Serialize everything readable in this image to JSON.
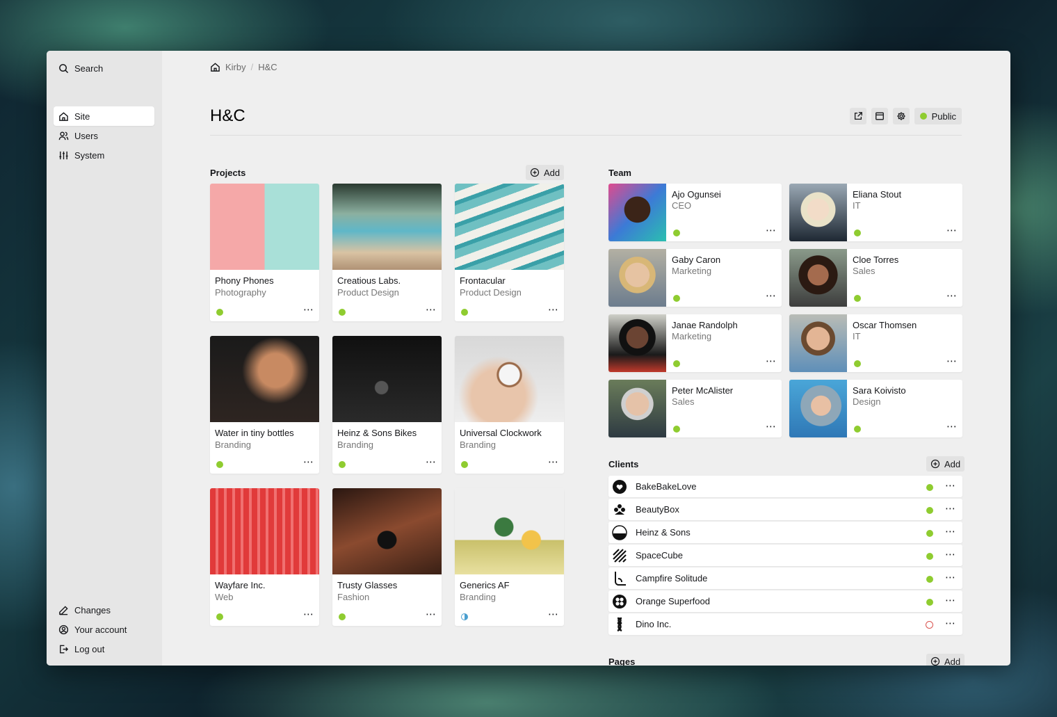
{
  "sidebar": {
    "search_label": "Search",
    "nav": [
      {
        "label": "Site",
        "active": true
      },
      {
        "label": "Users"
      },
      {
        "label": "System"
      }
    ],
    "bottom": [
      {
        "label": "Changes"
      },
      {
        "label": "Your account"
      },
      {
        "label": "Log out"
      }
    ]
  },
  "breadcrumb": {
    "root": "Kirby",
    "current": "H&C",
    "separator": "/"
  },
  "page": {
    "title": "H&C",
    "status_label": "Public",
    "status_color": "#8fcc30"
  },
  "projects": {
    "title": "Projects",
    "add_label": "Add",
    "items": [
      {
        "title": "Phony Phones",
        "category": "Photography",
        "status": "published"
      },
      {
        "title": "Creatious Labs.",
        "category": "Product Design",
        "status": "published"
      },
      {
        "title": "Frontacular",
        "category": "Product Design",
        "status": "published"
      },
      {
        "title": "Water in tiny bottles",
        "category": "Branding",
        "status": "published"
      },
      {
        "title": "Heinz & Sons Bikes",
        "category": "Branding",
        "status": "published"
      },
      {
        "title": "Universal Clockwork",
        "category": "Branding",
        "status": "published"
      },
      {
        "title": "Wayfare Inc.",
        "category": "Web",
        "status": "published"
      },
      {
        "title": "Trusty Glasses",
        "category": "Fashion",
        "status": "published"
      },
      {
        "title": "Generics AF",
        "category": "Branding",
        "status": "unlisted"
      }
    ]
  },
  "team": {
    "title": "Team",
    "members": [
      {
        "name": "Ajo Ogunsei",
        "role": "CEO"
      },
      {
        "name": "Eliana Stout",
        "role": "IT"
      },
      {
        "name": "Gaby Caron",
        "role": "Marketing"
      },
      {
        "name": "Cloe Torres",
        "role": "Sales"
      },
      {
        "name": "Janae Randolph",
        "role": "Marketing"
      },
      {
        "name": "Oscar Thomsen",
        "role": "IT"
      },
      {
        "name": "Peter McAlister",
        "role": "Sales"
      },
      {
        "name": "Sara Koivisto",
        "role": "Design"
      }
    ]
  },
  "clients": {
    "title": "Clients",
    "add_label": "Add",
    "items": [
      {
        "name": "BakeBakeLove",
        "status": "published"
      },
      {
        "name": "BeautyBox",
        "status": "published"
      },
      {
        "name": "Heinz & Sons",
        "status": "published"
      },
      {
        "name": "SpaceCube",
        "status": "published"
      },
      {
        "name": "Campfire Solitude",
        "status": "published"
      },
      {
        "name": "Orange Superfood",
        "status": "published"
      },
      {
        "name": "Dino Inc.",
        "status": "draft"
      }
    ]
  },
  "pages": {
    "title": "Pages",
    "add_label": "Add"
  },
  "more_label": "⋯"
}
